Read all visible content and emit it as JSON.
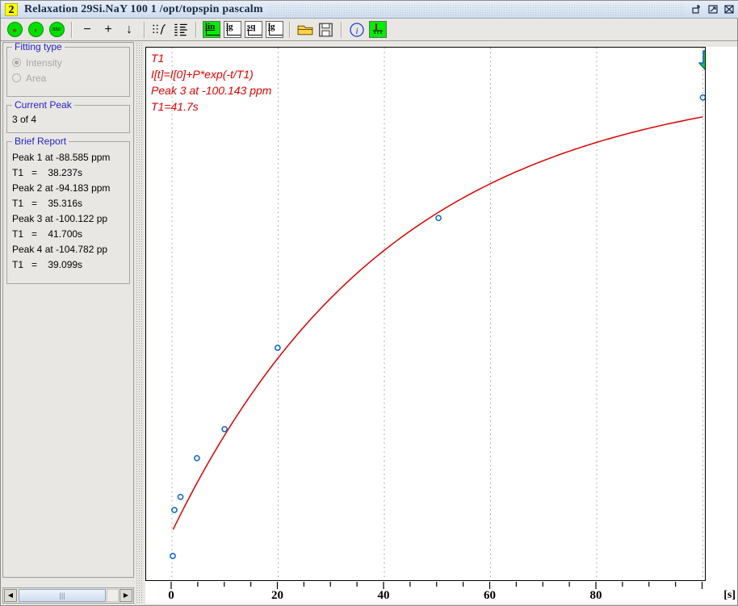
{
  "window": {
    "number": "2",
    "title": "Relaxation 29Si.NaY  100  1  /opt/topspin  pascalm",
    "buttons": [
      {
        "name": "restore-button",
        "label": "Restore"
      },
      {
        "name": "maximize-button",
        "label": "Maximize"
      },
      {
        "name": "close-button",
        "label": "Close"
      }
    ]
  },
  "toolbar": {
    "items": [
      {
        "name": "fit-all-button",
        "icon": "double-chevron-green-icon",
        "label": "»"
      },
      {
        "name": "fit-next-button",
        "icon": "chevron-green-icon",
        "label": "›"
      },
      {
        "name": "ascii-button",
        "icon": "asc-green-icon",
        "label": "asc"
      },
      {
        "name": "zoom-out-button",
        "icon": "minus-icon",
        "label": "−"
      },
      {
        "name": "zoom-in-button",
        "icon": "plus-icon",
        "label": "+"
      },
      {
        "name": "down-button",
        "icon": "arrow-down-icon",
        "label": "↓"
      },
      {
        "name": "points-view-button",
        "icon": "scatter-points-icon",
        "label": ""
      },
      {
        "name": "list-view-button",
        "icon": "list-lines-icon",
        "label": ""
      },
      {
        "name": "scale-lin-button",
        "icon": "lin-axis-icon",
        "label": "lin",
        "selected": true
      },
      {
        "name": "scale-lg-button",
        "icon": "lg-axis-icon",
        "label": "lg",
        "selected": false
      },
      {
        "name": "scale-sq-button",
        "icon": "sq-axis-icon",
        "label": "sq",
        "selected": false
      },
      {
        "name": "scale-lg2-button",
        "icon": "lg-axis-icon",
        "label": "lg",
        "selected": false
      },
      {
        "name": "open-button",
        "icon": "folder-icon",
        "label": ""
      },
      {
        "name": "save-button",
        "icon": "floppy-disk-icon",
        "label": ""
      },
      {
        "name": "info-button",
        "icon": "info-circle-icon",
        "label": "i"
      },
      {
        "name": "intensity-button",
        "icon": "intensity-axis-icon",
        "label": "I",
        "selected": true
      }
    ]
  },
  "sidebar": {
    "fitting_type": {
      "title": "Fitting type",
      "options": [
        {
          "label": "Intensity",
          "selected": true
        },
        {
          "label": "Area",
          "selected": false
        }
      ]
    },
    "current_peak": {
      "title": "Current Peak",
      "value": "3 of 4"
    },
    "brief_report": {
      "title": "Brief Report",
      "lines": [
        "Peak 1 at -88.585 ppm",
        "T1   =    38.237s",
        "Peak 2 at -94.183 ppm",
        "T1   =    35.316s",
        "Peak 3 at -100.122 pp",
        "T1   =    41.700s",
        "Peak 4 at -104.782 pp",
        "T1   =    39.099s"
      ]
    },
    "scrollbar": {
      "left_arrow": "◀",
      "right_arrow": "▶",
      "grip": "|||"
    }
  },
  "chart_data": {
    "type": "scatter",
    "title": "T1",
    "annotations": [
      "T1",
      "I[t]=I[0]+P*exp(-t/T1)",
      "Peak 3 at -100.143 ppm",
      "T1=41.7s"
    ],
    "xlabel": "[s]",
    "ylabel": "",
    "xlim": [
      -5,
      105
    ],
    "xticks": [
      0,
      20,
      40,
      60,
      80
    ],
    "xtick_labels": [
      "0",
      "20",
      "40",
      "60",
      "80"
    ],
    "xminor_step": 5,
    "grid": "vertical-dotted-at-major-ticks",
    "legend": "none",
    "series": [
      {
        "name": "measured-intensity",
        "marker": "open-circle",
        "color": "#0a62c8",
        "points": [
          {
            "x": 0.15,
            "y": 0.02
          },
          {
            "x": 0.45,
            "y": 0.115
          },
          {
            "x": 1.6,
            "y": 0.142
          },
          {
            "x": 4.7,
            "y": 0.222
          },
          {
            "x": 9.9,
            "y": 0.282
          },
          {
            "x": 19.9,
            "y": 0.45
          },
          {
            "x": 50.2,
            "y": 0.718
          },
          {
            "x": 100.0,
            "y": 0.967
          }
        ]
      },
      {
        "name": "fit-curve",
        "marker": "line",
        "color": "#dd0000",
        "model": "I[t]=I[0]+P*exp(-t/T1)",
        "T1": 41.7,
        "x_start": 0.2,
        "x_end": 100.0,
        "y_start": 0.07,
        "y_end": 0.927
      }
    ],
    "cursor_marker": {
      "name": "green-down-arrow",
      "x": 100.0,
      "color": "#00e000"
    }
  }
}
